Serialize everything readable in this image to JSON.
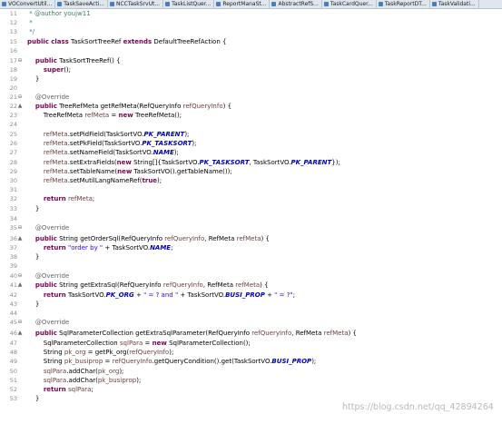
{
  "tabs": [
    {
      "label": "VOConvertUtil..."
    },
    {
      "label": "TaskSaveActi..."
    },
    {
      "label": "NCCTaskSrvUt..."
    },
    {
      "label": "TaskListQuer..."
    },
    {
      "label": "ReportManaSt..."
    },
    {
      "label": "AbstractRefS..."
    },
    {
      "label": "TaskCardQuer..."
    },
    {
      "label": "TaskReportDT..."
    },
    {
      "label": "TaskValidati..."
    }
  ],
  "lines": [
    {
      "n": "11",
      "m": "",
      "t": [
        [
          "cm",
          " * "
        ],
        [
          "cm",
          "@author"
        ],
        [
          "cm",
          " youjw11"
        ]
      ]
    },
    {
      "n": "12",
      "m": "",
      "t": [
        [
          "cm",
          " *"
        ]
      ]
    },
    {
      "n": "13",
      "m": "",
      "t": [
        [
          "cm",
          " */"
        ]
      ]
    },
    {
      "n": "15",
      "m": "",
      "t": [
        [
          "kw",
          "public"
        ],
        [
          "p",
          " "
        ],
        [
          "kw",
          "class"
        ],
        [
          "p",
          " TaskSortTreeRef "
        ],
        [
          "kw",
          "extends"
        ],
        [
          "p",
          " DefaultTreeRefAction {"
        ]
      ]
    },
    {
      "n": "16",
      "m": "",
      "t": []
    },
    {
      "n": "17",
      "m": "⊖",
      "t": [
        [
          "p",
          "    "
        ],
        [
          "kw",
          "public"
        ],
        [
          "p",
          " TaskSortTreeRef() {"
        ]
      ]
    },
    {
      "n": "18",
      "m": "",
      "t": [
        [
          "p",
          "        "
        ],
        [
          "kw",
          "super"
        ],
        [
          "p",
          "();"
        ]
      ]
    },
    {
      "n": "19",
      "m": "",
      "t": [
        [
          "p",
          "    }"
        ]
      ]
    },
    {
      "n": "20",
      "m": "",
      "t": []
    },
    {
      "n": "21",
      "m": "⊖",
      "t": [
        [
          "p",
          "    "
        ],
        [
          "an",
          "@Override"
        ]
      ]
    },
    {
      "n": "22",
      "m": "▲",
      "t": [
        [
          "p",
          "    "
        ],
        [
          "kw",
          "public"
        ],
        [
          "p",
          " TreeRefMeta getRefMeta(RefQueryInfo "
        ],
        [
          "prm",
          "refQueryInfo"
        ],
        [
          "p",
          ") {"
        ]
      ]
    },
    {
      "n": "23",
      "m": "",
      "t": [
        [
          "p",
          "        TreeRefMeta "
        ],
        [
          "lcl",
          "refMeta"
        ],
        [
          "p",
          " = "
        ],
        [
          "kw",
          "new"
        ],
        [
          "p",
          " TreeRefMeta();"
        ]
      ]
    },
    {
      "n": "24",
      "m": "",
      "t": []
    },
    {
      "n": "25",
      "m": "",
      "t": [
        [
          "p",
          "        "
        ],
        [
          "lcl",
          "refMeta"
        ],
        [
          "p",
          ".setPidField(TaskSortVO."
        ],
        [
          "sf",
          "PK_PARENT"
        ],
        [
          "p",
          ");"
        ]
      ]
    },
    {
      "n": "26",
      "m": "",
      "t": [
        [
          "p",
          "        "
        ],
        [
          "lcl",
          "refMeta"
        ],
        [
          "p",
          ".setPkField(TaskSortVO."
        ],
        [
          "sf",
          "PK_TASKSORT"
        ],
        [
          "p",
          ");"
        ]
      ]
    },
    {
      "n": "27",
      "m": "",
      "t": [
        [
          "p",
          "        "
        ],
        [
          "lcl",
          "refMeta"
        ],
        [
          "p",
          ".setNameField(TaskSortVO."
        ],
        [
          "sf",
          "NAME"
        ],
        [
          "p",
          ");"
        ]
      ]
    },
    {
      "n": "28",
      "m": "",
      "t": [
        [
          "p",
          "        "
        ],
        [
          "lcl",
          "refMeta"
        ],
        [
          "p",
          ".setExtraFields("
        ],
        [
          "kw",
          "new"
        ],
        [
          "p",
          " String[]{TaskSortVO."
        ],
        [
          "sf",
          "PK_TASKSORT"
        ],
        [
          "p",
          ", TaskSortVO."
        ],
        [
          "sf",
          "PK_PARENT"
        ],
        [
          "p",
          "});"
        ]
      ]
    },
    {
      "n": "29",
      "m": "",
      "t": [
        [
          "p",
          "        "
        ],
        [
          "lcl",
          "refMeta"
        ],
        [
          "p",
          ".setTableName("
        ],
        [
          "kw",
          "new"
        ],
        [
          "p",
          " TaskSortVO().getTableName());"
        ]
      ]
    },
    {
      "n": "30",
      "m": "",
      "t": [
        [
          "p",
          "        "
        ],
        [
          "lcl",
          "refMeta"
        ],
        [
          "p",
          ".setMutilLangNameRef("
        ],
        [
          "kw",
          "true"
        ],
        [
          "p",
          ");"
        ]
      ]
    },
    {
      "n": "31",
      "m": "",
      "t": []
    },
    {
      "n": "32",
      "m": "",
      "t": [
        [
          "p",
          "        "
        ],
        [
          "kw",
          "return"
        ],
        [
          "p",
          " "
        ],
        [
          "lcl",
          "refMeta"
        ],
        [
          "p",
          ";"
        ]
      ]
    },
    {
      "n": "33",
      "m": "",
      "t": [
        [
          "p",
          "    }"
        ]
      ]
    },
    {
      "n": "34",
      "m": "",
      "t": []
    },
    {
      "n": "35",
      "m": "⊖",
      "t": [
        [
          "p",
          "    "
        ],
        [
          "an",
          "@Override"
        ]
      ]
    },
    {
      "n": "36",
      "m": "▲",
      "t": [
        [
          "p",
          "    "
        ],
        [
          "kw",
          "public"
        ],
        [
          "p",
          " String getOrderSql(RefQueryInfo "
        ],
        [
          "prm",
          "refQueryInfo"
        ],
        [
          "p",
          ", RefMeta "
        ],
        [
          "prm",
          "refMeta"
        ],
        [
          "p",
          ") {"
        ]
      ]
    },
    {
      "n": "37",
      "m": "",
      "t": [
        [
          "p",
          "        "
        ],
        [
          "kw",
          "return"
        ],
        [
          "p",
          " "
        ],
        [
          "str",
          "\"order by \""
        ],
        [
          "p",
          " + TaskSortVO."
        ],
        [
          "sf",
          "NAME"
        ],
        [
          "p",
          ";"
        ]
      ]
    },
    {
      "n": "38",
      "m": "",
      "t": [
        [
          "p",
          "    }"
        ]
      ]
    },
    {
      "n": "39",
      "m": "",
      "t": []
    },
    {
      "n": "40",
      "m": "⊖",
      "t": [
        [
          "p",
          "    "
        ],
        [
          "an",
          "@Override"
        ]
      ]
    },
    {
      "n": "41",
      "m": "▲",
      "t": [
        [
          "p",
          "    "
        ],
        [
          "kw",
          "public"
        ],
        [
          "p",
          " String getExtraSql(RefQueryInfo "
        ],
        [
          "prm",
          "refQueryInfo"
        ],
        [
          "p",
          ", RefMeta "
        ],
        [
          "prm",
          "refMeta"
        ],
        [
          "p",
          ") {"
        ]
      ]
    },
    {
      "n": "42",
      "m": "",
      "t": [
        [
          "p",
          "        "
        ],
        [
          "kw",
          "return"
        ],
        [
          "p",
          " TaskSortVO."
        ],
        [
          "sf",
          "PK_ORG"
        ],
        [
          "p",
          " + "
        ],
        [
          "str",
          "\" = ? and \""
        ],
        [
          "p",
          " + TaskSortVO."
        ],
        [
          "sf",
          "BUSI_PROP"
        ],
        [
          "p",
          " + "
        ],
        [
          "str",
          "\" = ?\""
        ],
        [
          "p",
          ";"
        ]
      ]
    },
    {
      "n": "43",
      "m": "",
      "t": [
        [
          "p",
          "    }"
        ]
      ]
    },
    {
      "n": "44",
      "m": "",
      "t": []
    },
    {
      "n": "45",
      "m": "⊖",
      "t": [
        [
          "p",
          "    "
        ],
        [
          "an",
          "@Override"
        ]
      ]
    },
    {
      "n": "46",
      "m": "▲",
      "t": [
        [
          "p",
          "    "
        ],
        [
          "kw",
          "public"
        ],
        [
          "p",
          " SqlParameterCollection getExtraSqlParameter(RefQueryInfo "
        ],
        [
          "prm",
          "refQueryInfo"
        ],
        [
          "p",
          ", RefMeta "
        ],
        [
          "prm",
          "refMeta"
        ],
        [
          "p",
          ") {"
        ]
      ]
    },
    {
      "n": "47",
      "m": "",
      "t": [
        [
          "p",
          "        SqlParameterCollection "
        ],
        [
          "lcl",
          "sqlPara"
        ],
        [
          "p",
          " = "
        ],
        [
          "kw",
          "new"
        ],
        [
          "p",
          " SqlParameterCollection();"
        ]
      ]
    },
    {
      "n": "48",
      "m": "",
      "t": [
        [
          "p",
          "        String "
        ],
        [
          "lcl",
          "pk_org"
        ],
        [
          "p",
          " = getPk_org("
        ],
        [
          "prm",
          "refQueryInfo"
        ],
        [
          "p",
          ");"
        ]
      ]
    },
    {
      "n": "49",
      "m": "",
      "t": [
        [
          "p",
          "        String "
        ],
        [
          "lcl",
          "pk_busiprop"
        ],
        [
          "p",
          " = "
        ],
        [
          "prm",
          "refQueryInfo"
        ],
        [
          "p",
          ".getQueryCondition().get(TaskSortVO."
        ],
        [
          "sf",
          "BUSI_PROP"
        ],
        [
          "p",
          ");"
        ]
      ]
    },
    {
      "n": "50",
      "m": "",
      "t": [
        [
          "p",
          "        "
        ],
        [
          "lcl",
          "sqlPara"
        ],
        [
          "p",
          ".addChar("
        ],
        [
          "lcl",
          "pk_org"
        ],
        [
          "p",
          ");"
        ]
      ]
    },
    {
      "n": "51",
      "m": "",
      "t": [
        [
          "p",
          "        "
        ],
        [
          "lcl",
          "sqlPara"
        ],
        [
          "p",
          ".addChar("
        ],
        [
          "lcl",
          "pk_busiprop"
        ],
        [
          "p",
          ");"
        ]
      ]
    },
    {
      "n": "52",
      "m": "",
      "t": [
        [
          "p",
          "        "
        ],
        [
          "kw",
          "return"
        ],
        [
          "p",
          " "
        ],
        [
          "lcl",
          "sqlPara"
        ],
        [
          "p",
          ";"
        ]
      ]
    },
    {
      "n": "53",
      "m": "",
      "t": [
        [
          "p",
          "    }"
        ]
      ]
    }
  ],
  "watermark": "https://blog.csdn.net/qq_42894264"
}
